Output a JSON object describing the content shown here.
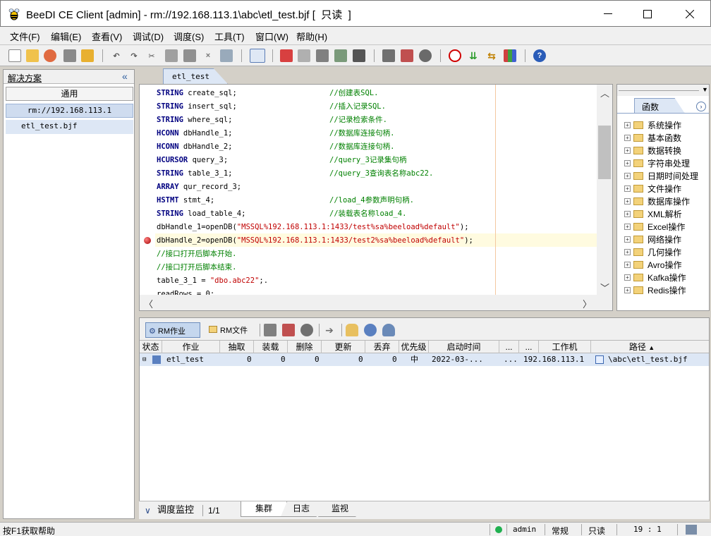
{
  "window": {
    "title": "BeeDI CE Client [admin] - rm://192.168.113.1\\abc\\etl_test.bjf [  只读  ]"
  },
  "menu": [
    "文件(F)",
    "编辑(E)",
    "查看(V)",
    "调试(D)",
    "调度(S)",
    "工具(T)",
    "窗口(W)",
    "帮助(H)"
  ],
  "left_panel": {
    "title": "解决方案",
    "tab": "通用",
    "server": "rm://192.168.113.1",
    "file": "etl_test.bjf"
  },
  "editor": {
    "tab": "etl_test",
    "lines": [
      {
        "kw": "STRING",
        "text": " create_sql;",
        "comment": "//创建表SQL."
      },
      {
        "kw": "STRING",
        "text": " insert_sql;",
        "comment": "//插入记录SQL."
      },
      {
        "kw": "STRING",
        "text": " where_sql;",
        "comment": "//记录检索条件."
      },
      {
        "kw": "HCONN",
        "text": " dbHandle_1;",
        "comment": "//数据库连接句柄."
      },
      {
        "kw": "HCONN",
        "text": " dbHandle_2;",
        "comment": "//数据库连接句柄."
      },
      {
        "kw": "HCURSOR",
        "text": " query_3;",
        "comment": "//query_3记录集句柄"
      },
      {
        "kw": "STRING",
        "text": " table_3_1;",
        "comment": "//query_3查询表名称abc22."
      },
      {
        "kw": "ARRAY",
        "text": " qur_record_3;",
        "comment": ""
      },
      {
        "kw": "HSTMT",
        "text": " stmt_4;",
        "comment": "//load_4参数声明句柄."
      },
      {
        "kw": "STRING",
        "text": " load_table_4;",
        "comment": "//装载表名称load_4."
      },
      {
        "pre": "dbHandle_1=openDB(",
        "str": "\"MSSQL%192.168.113.1:1433/test%sa%beeload%default\"",
        "post": ");"
      },
      {
        "pre": "dbHandle_2=openDB(",
        "str": "\"MSSQL%192.168.113.1:1433/test2%sa%beeload%default\"",
        "post": ");"
      },
      {
        "cmt": "//接口打开后脚本开始."
      },
      {
        "cmt": "//接口打开后脚本结束."
      },
      {
        "pre": "table_3_1 = ",
        "str": "\"dbo.abc22\"",
        "post": ";."
      },
      {
        "pre": "readRows = 0;"
      }
    ]
  },
  "functions": {
    "tab": "函数",
    "items": [
      "系统操作",
      "基本函数",
      "数据转换",
      "字符串处理",
      "日期时间处理",
      "文件操作",
      "数据库操作",
      "XML解析",
      "Excel操作",
      "网络操作",
      "几何操作",
      "Avro操作",
      "Kafka操作",
      "Redis操作"
    ]
  },
  "bottom": {
    "btn_rm_job": "RM作业",
    "btn_rm_file": "RM文件",
    "columns": [
      "状态",
      "作业",
      "抽取",
      "装载",
      "删除",
      "更新",
      "丢弃",
      "优先级",
      "启动时间",
      "...",
      "...",
      "工作机",
      "路径"
    ],
    "row": {
      "job": "etl_test",
      "extract": "0",
      "load": "0",
      "delete": "0",
      "update": "0",
      "discard": "0",
      "priority": "中",
      "start": "2022-03-...",
      "c1": "...",
      "worker": "192.168.113.1",
      "path": "\\abc\\etl_test.bjf"
    },
    "monitor_label": "调度监控",
    "page": "1/1",
    "tabs": [
      "集群",
      "日志",
      "监视"
    ]
  },
  "status": {
    "help": "按F1获取帮助",
    "user": "admin",
    "mode": "常规",
    "readonly": "只读",
    "position": "19 : 1"
  }
}
